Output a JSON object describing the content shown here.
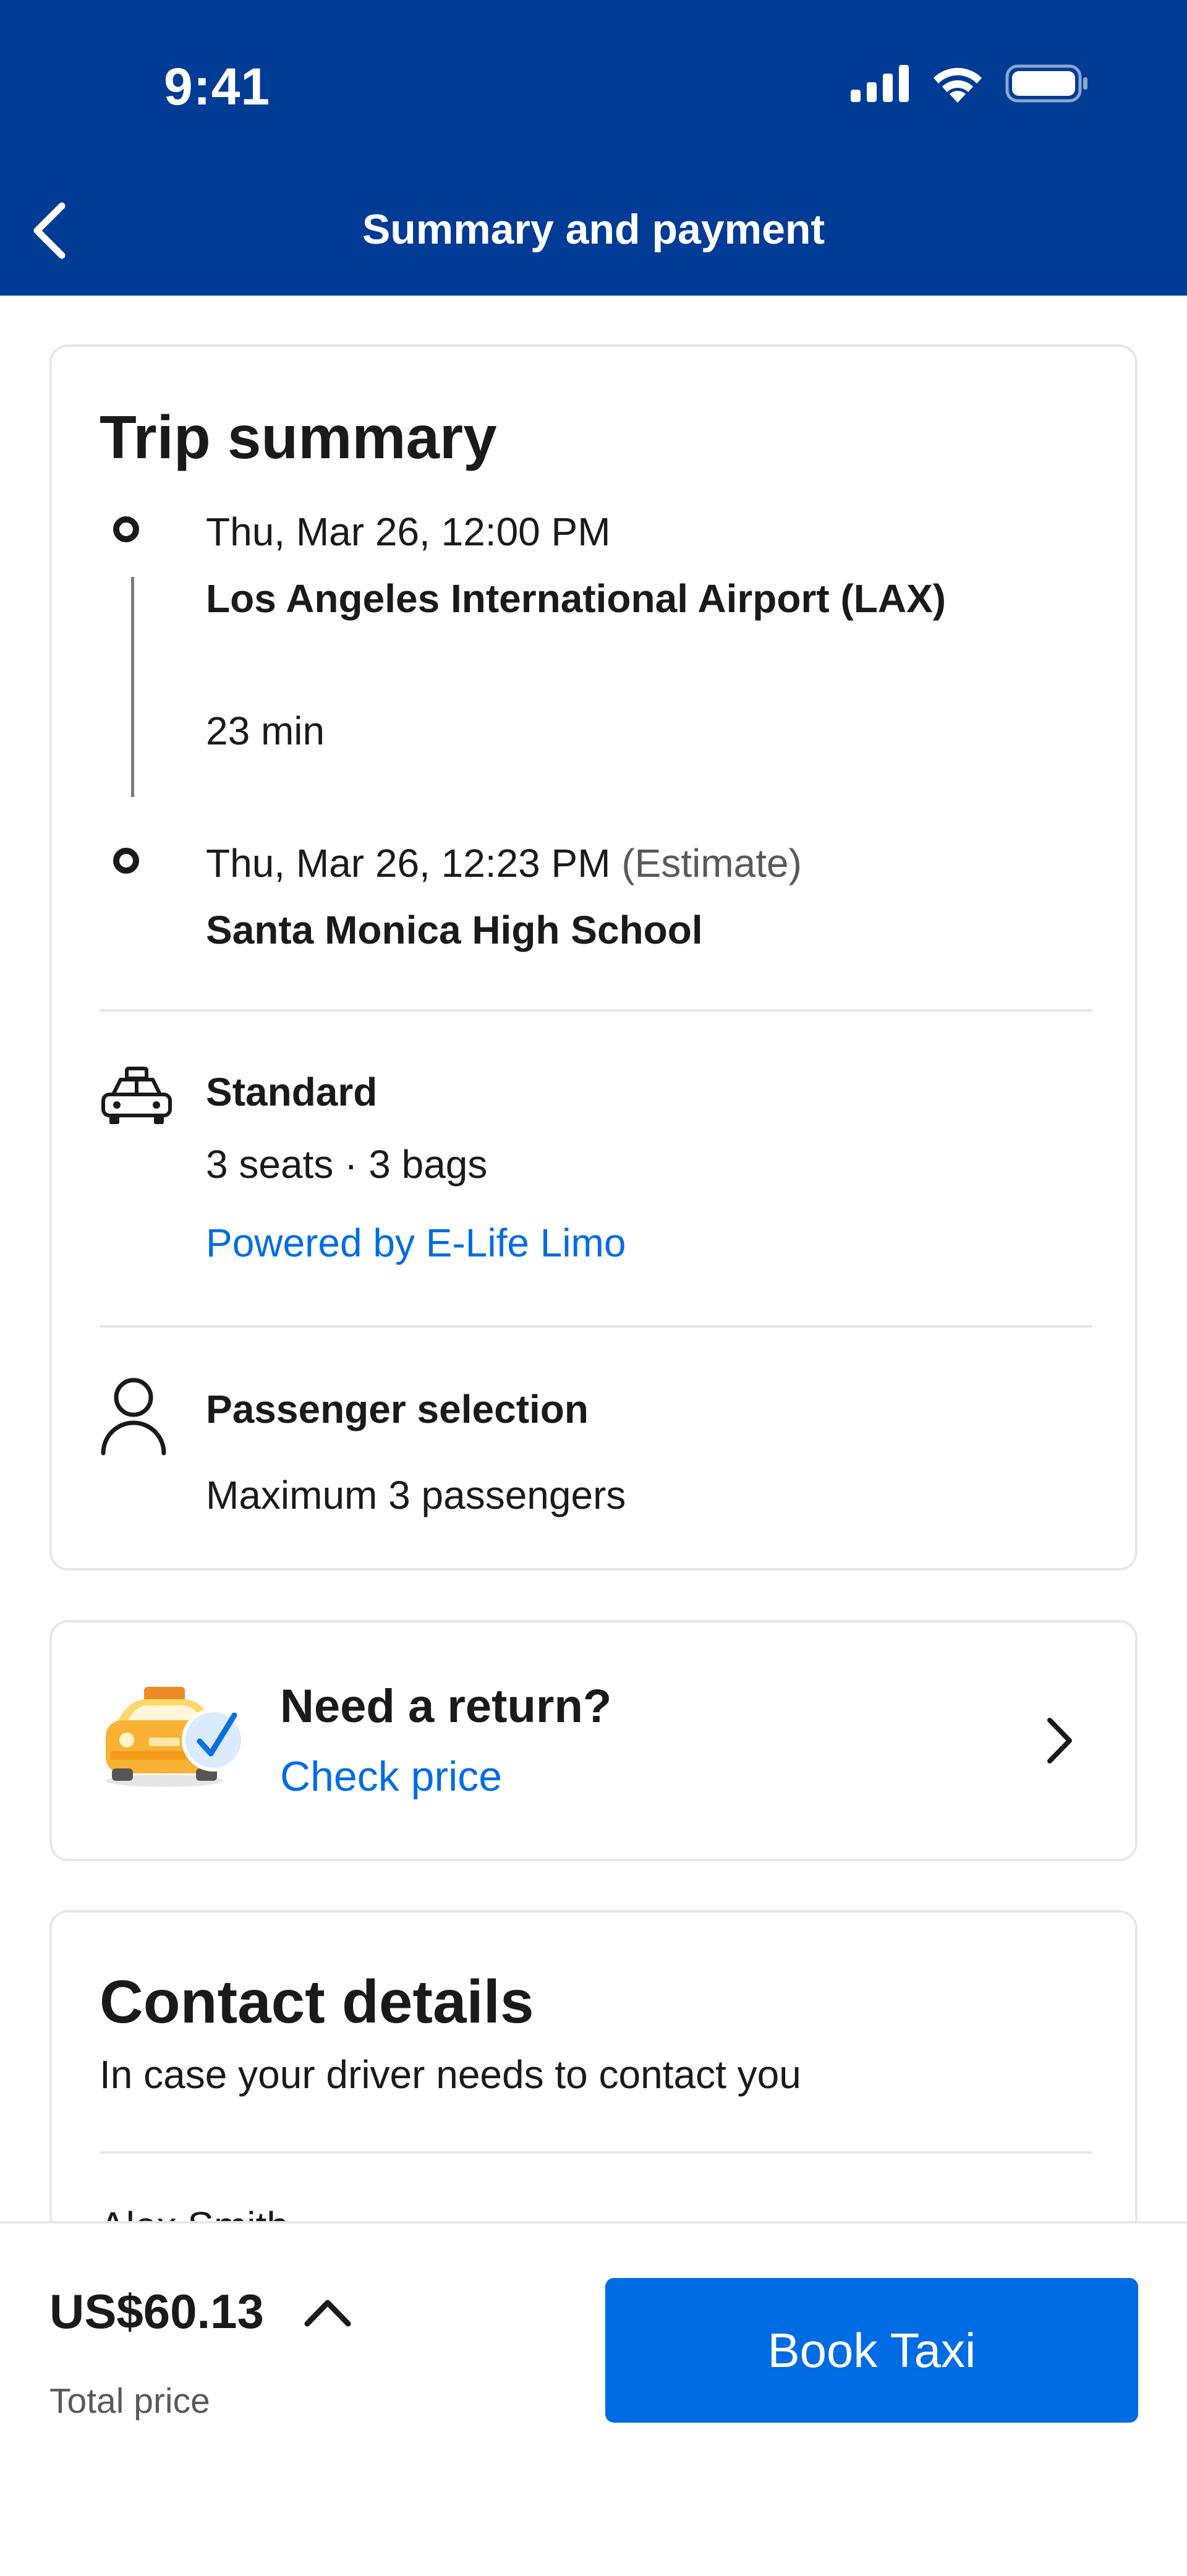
{
  "status_bar": {
    "time": "9:41"
  },
  "header": {
    "title": "Summary and payment"
  },
  "trip": {
    "heading": "Trip summary",
    "pickup": {
      "datetime": "Thu, Mar 26, 12:00 PM",
      "place": "Los Angeles International Airport (LAX)"
    },
    "duration": "23 min",
    "dropoff": {
      "datetime": "Thu, Mar 26, 12:23 PM",
      "estimate": "(Estimate)",
      "place": "Santa Monica High School"
    },
    "vehicle": {
      "name": "Standard",
      "capacity": "3 seats · 3 bags",
      "provider": "Powered by E-Life Limo"
    },
    "passenger": {
      "title": "Passenger selection",
      "detail": "Maximum 3 passengers"
    }
  },
  "return_card": {
    "title": "Need a return?",
    "link": "Check price"
  },
  "contact": {
    "heading": "Contact details",
    "subtitle": "In case your driver needs to contact you",
    "name_partial": "Alex Smith"
  },
  "footer": {
    "price": "US$60.13",
    "price_label": "Total price",
    "book_button": "Book Taxi"
  },
  "colors": {
    "brand_blue": "#003b95",
    "action_blue": "#006ce4",
    "border": "#e7e7e7"
  },
  "icons": [
    "signal-icon",
    "wifi-icon",
    "battery-icon",
    "back-arrow-icon",
    "taxi-icon",
    "person-icon",
    "taxi-return-illustration",
    "chevron-right-icon",
    "chevron-up-icon"
  ]
}
